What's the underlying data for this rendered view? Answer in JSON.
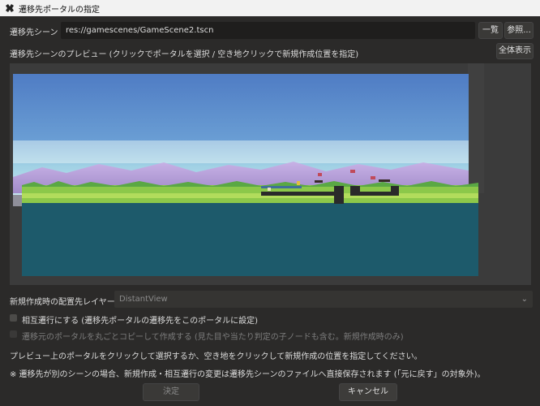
{
  "window": {
    "title": "遷移先ポータルの指定"
  },
  "scene": {
    "label": "遷移先シーン",
    "path": "res://gamescenes/GameScene2.tscn",
    "list_button": "一覧",
    "browse_button": "参照..."
  },
  "preview": {
    "caption": "遷移先シーンのプレビュー (クリックでポータルを選択 / 空き地クリックで新規作成位置を指定)",
    "fit_button": "全体表示"
  },
  "layer": {
    "label": "新規作成時の配置先レイヤー",
    "selected": "DistantView"
  },
  "options": {
    "mutual_label": "相互遷行にする (遷移先ポータルの遷移先をこのポータルに設定)",
    "mutual_checked": false,
    "copy_label": "遷移元のポータルを丸ごとコピーして作成する (見た目や当たり判定の子ノードも含む。新規作成時のみ)",
    "copy_checked": false,
    "copy_enabled": false
  },
  "hints": {
    "hint1": "プレビュー上のポータルをクリックして選択するか、空き地をクリックして新規作成の位置を指定してください。",
    "hint2": "※ 遷移先が別のシーンの場合、新規作成・相互遷行の変更は遷移先シーンのファイルへ直接保存されます (「元に戻す」の対象外)。"
  },
  "footer": {
    "ok_label": "決定",
    "cancel_label": "キャンセル"
  },
  "colors": {
    "background": "#2b2a29",
    "sky": "#5b86c8",
    "ground": "#1f5a6e",
    "grass": "#8cc84a"
  }
}
